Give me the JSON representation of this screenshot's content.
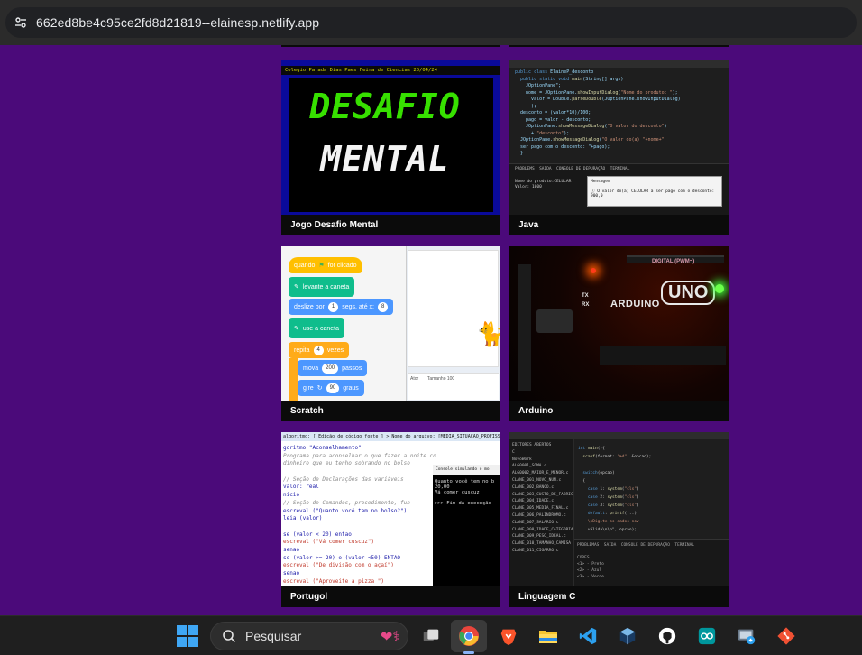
{
  "browser": {
    "url": "662ed8be4c95ce2fd8d21819--elainesp.netlify.app",
    "site_icon": "tune-icon"
  },
  "gallery": {
    "cards": [
      {
        "title": "Jogo Desafio Mental",
        "image": "desafio-mental-thumbnail"
      },
      {
        "title": "Java",
        "image": "java-code-thumbnail"
      },
      {
        "title": "Scratch",
        "image": "scratch-blocks-thumbnail"
      },
      {
        "title": "Arduino",
        "image": "arduino-board-thumbnail"
      },
      {
        "title": "Portugol",
        "image": "portugol-code-thumbnail"
      },
      {
        "title": "Linguagem C",
        "image": "c-code-thumbnail"
      }
    ],
    "desafio": {
      "bar_text": "Colegio Parada Dias Paes   Feira de Ciencias   20/04/24",
      "line1": "DESAFIO",
      "line2": "MENTAL"
    },
    "scratch": {
      "b1": "quando",
      "b1b": "for clicado",
      "b2": "levante a caneta",
      "b3a": "deslize por",
      "b3v": "1",
      "b3b": "segs. até x:",
      "b3x": "8",
      "b4": "use a caneta",
      "b5a": "repita",
      "b5v": "4",
      "b5b": "vezes",
      "b6a": "mova",
      "b6v": "200",
      "b6b": "passos",
      "b7a": "gire",
      "b7v": "90",
      "b7b": "graus",
      "sprite_label": "Ator",
      "size_label": "Tamanho",
      "size_value": "100"
    },
    "arduino": {
      "brand": "ARDUINO",
      "model": "UNO",
      "digital": "DIGITAL (PWM~)",
      "tx": "TX",
      "rx": "RX"
    },
    "portugol": {
      "header": "algoritmo: [ Edição de código fonte ] > Nome do arquivo: [MEDIA_SITUACAO_PROFISSIONAL]",
      "lines": [
        "goritmo \"Aconselhamento\"",
        "Programa para aconselhar o que fazer a noite com o",
        "dinheiro que eu tenho sobrando no bolso",
        "",
        "// Seção de Declarações das variáveis",
        "valor: real",
        "nicio",
        "// Seção de Comandos, procedimento, fun",
        "  escreval (\"Quanto você tem no bolso?\")",
        "leia (valor)",
        "",
        "se (valor < 20) entao",
        "   escreval (\"Vá comer cuscuz\")",
        "senao",
        "   se (valor >= 20) e (valor <50) ENTAO",
        "      escreval (\"De divisão com o açaí\")",
        "   senao",
        "      escreval (\"Aproveite a pizza \")",
        "   fimse"
      ],
      "console_title": "Console simulando o mo",
      "console_lines": [
        "Quanto você tem no b",
        "20,00",
        "Vá comer cuscuz",
        "",
        ">>> Fim da execução"
      ]
    }
  },
  "taskbar": {
    "search_placeholder": "Pesquisar",
    "apps": [
      "task-view-icon",
      "chrome-icon",
      "brave-icon",
      "file-explorer-icon",
      "vscode-icon",
      "virtualbox-icon",
      "github-icon",
      "arduino-ide-icon",
      "remote-desktop-icon",
      "git-icon"
    ],
    "colors": {
      "chrome": "#e8453c",
      "brave": "#fb542b",
      "vscode": "#2ca0ee",
      "arduino": "#00979d",
      "git": "#f05133",
      "explorer": "#f4c430"
    }
  }
}
